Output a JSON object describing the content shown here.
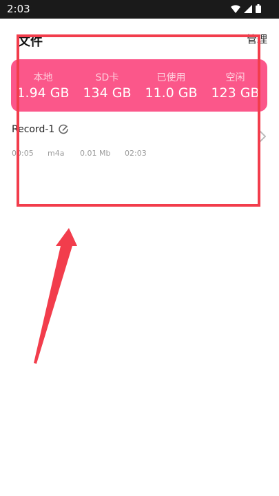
{
  "status_bar": {
    "time": "2:03",
    "icons": [
      "wifi-icon",
      "cellular-signal-icon",
      "battery-icon"
    ]
  },
  "header": {
    "title": "文件",
    "manage_label": "管理"
  },
  "storage": {
    "local": {
      "label": "本地",
      "value": "1.94 GB"
    },
    "sd_card": {
      "label": "SD卡",
      "value": "134 GB"
    },
    "used": {
      "label": "已使用",
      "value": "11.0 GB"
    },
    "free": {
      "label": "空闲",
      "value": "123 GB"
    }
  },
  "recordings": [
    {
      "name": "Record-1",
      "duration": "00:05",
      "format": "m4a",
      "size": "0.01 Mb",
      "time": "02:03"
    }
  ],
  "colors": {
    "status_bar": "#1a1a1a",
    "storage_card": "#fb578a",
    "annotation": "#f23d4c",
    "meta_text": "#9a9a9a"
  }
}
